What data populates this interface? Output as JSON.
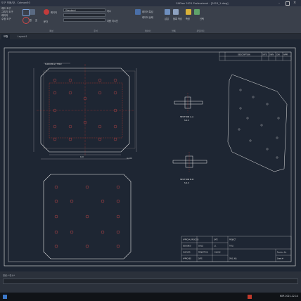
{
  "window": {
    "title": "CADian 2021 Professional - [2015_1.dwg]",
    "left_title": "도구 모음/창 - Calmon50"
  },
  "ribbon": {
    "menu_items": [
      "캐드 도구",
      "그리기 도구",
      "레이어",
      "수정 도구"
    ],
    "groups": [
      {
        "label": "",
        "buttons": [
          "원",
          "호"
        ]
      },
      {
        "label": "특성",
        "buttons": [
          "레이어",
          "문자"
        ]
      },
      {
        "label": "주석",
        "buttons": [
          "Standard",
          "치수",
          "다중 지시선"
        ]
      },
      {
        "label": "레이어",
        "buttons": [
          "레이어 특성",
          "레이어 상태"
        ]
      },
      {
        "label": "블록",
        "buttons": [
          "삽입",
          "블록 작성"
        ]
      },
      {
        "label": "유틸리티",
        "buttons": [
          "측정",
          "선택"
        ]
      }
    ],
    "style_dropdown": "Standard"
  },
  "tabs": [
    "모형",
    "Layout1"
  ],
  "drawing": {
    "title_block": {
      "headers": [
        "DESCRIPTION",
        "DATE",
        "DWN",
        "CHK",
        "APPR"
      ],
      "rows": [
        [
          "APPROVAL PROCESS",
          "DATE",
          "DWG",
          "PROJECT"
        ],
        [
          "DESIGNED",
          "SCALE",
          "1:1",
          "TITLE"
        ],
        [
          "CHECKED",
          "PROJECTION",
          "3 ANGLE",
          ""
        ],
        [
          "APPROVED",
          "DATE",
          "",
          "DWG. NO."
        ]
      ],
      "right_fields": [
        "Revision No.",
        "Sheet #"
      ]
    },
    "section_a": {
      "title": "SECTION A-A",
      "subtitle": "S:4.0"
    },
    "section_b": {
      "title": "SECTION B-B",
      "subtitle": "S:4.0"
    },
    "dims": [
      "8-Ø10(M12) THRU",
      "4-C20",
      "140"
    ]
  },
  "command": {
    "prompt": "명령: *취소*"
  },
  "taskbar": {
    "clock": "2021-12-14",
    "tray_text": "KOR"
  }
}
